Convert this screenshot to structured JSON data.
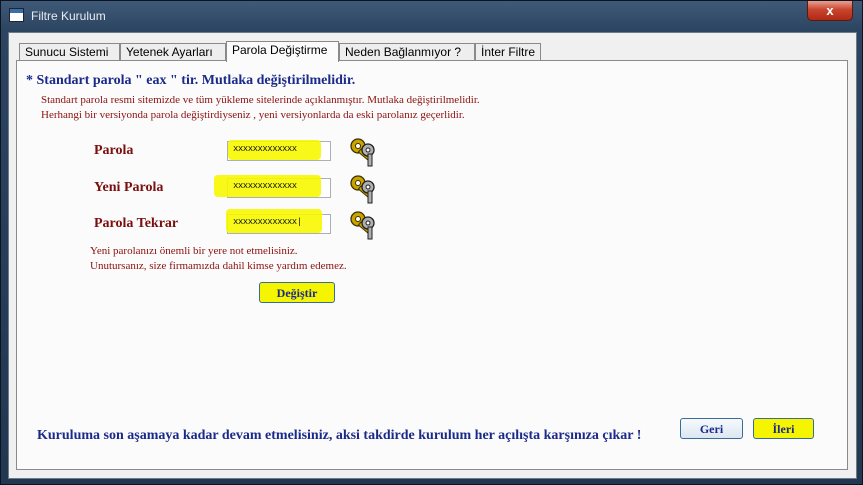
{
  "window": {
    "title": "Filtre Kurulum",
    "close_label": "x"
  },
  "tabs": [
    {
      "label": "Sunucu Sistemi"
    },
    {
      "label": "Yetenek Ayarları"
    },
    {
      "label": "Parola Değiştirme"
    },
    {
      "label": "Neden Bağlanmıyor ?"
    },
    {
      "label": "İnter Filtre"
    }
  ],
  "active_tab": "Parola Değiştirme",
  "panel": {
    "heading": "* Standart parola  \" eax \"  tir. Mutlaka değiştirilmelidir.",
    "info_line1": "Standart parola resmi sitemizde ve tüm yükleme sitelerinde açıklanmıştır. Mutlaka değiştirilmelidir.",
    "info_line2": "Herhangi bir versiyonda parola değiştirdiyseniz , yeni versiyonlarda da eski parolanız geçerlidir.",
    "fields": [
      {
        "label": "Parola",
        "value": "xxxxxxxxxxxxx"
      },
      {
        "label": "Yeni Parola",
        "value": "xxxxxxxxxxxxx"
      },
      {
        "label": "Parola Tekrar",
        "value": "xxxxxxxxxxxxx|"
      }
    ],
    "note_line1": "Yeni parolanızı önemli bir yere not etmelisiniz.",
    "note_line2": "Unutursanız, size firmamızda dahil kimse yardım edemez.",
    "change_button": "Değiştir"
  },
  "nav": {
    "back_button": "Geri",
    "next_button": "İleri"
  },
  "footer_text": "Kuruluma son aşamaya kadar devam etmelisiniz, aksi takdirde kurulum her açılışta karşınıza çıkar !",
  "colors": {
    "highlight": "#f7f700",
    "heading": "#1a2a8a",
    "label": "#7a0f0f"
  },
  "icons": {
    "key": "keys-icon"
  }
}
